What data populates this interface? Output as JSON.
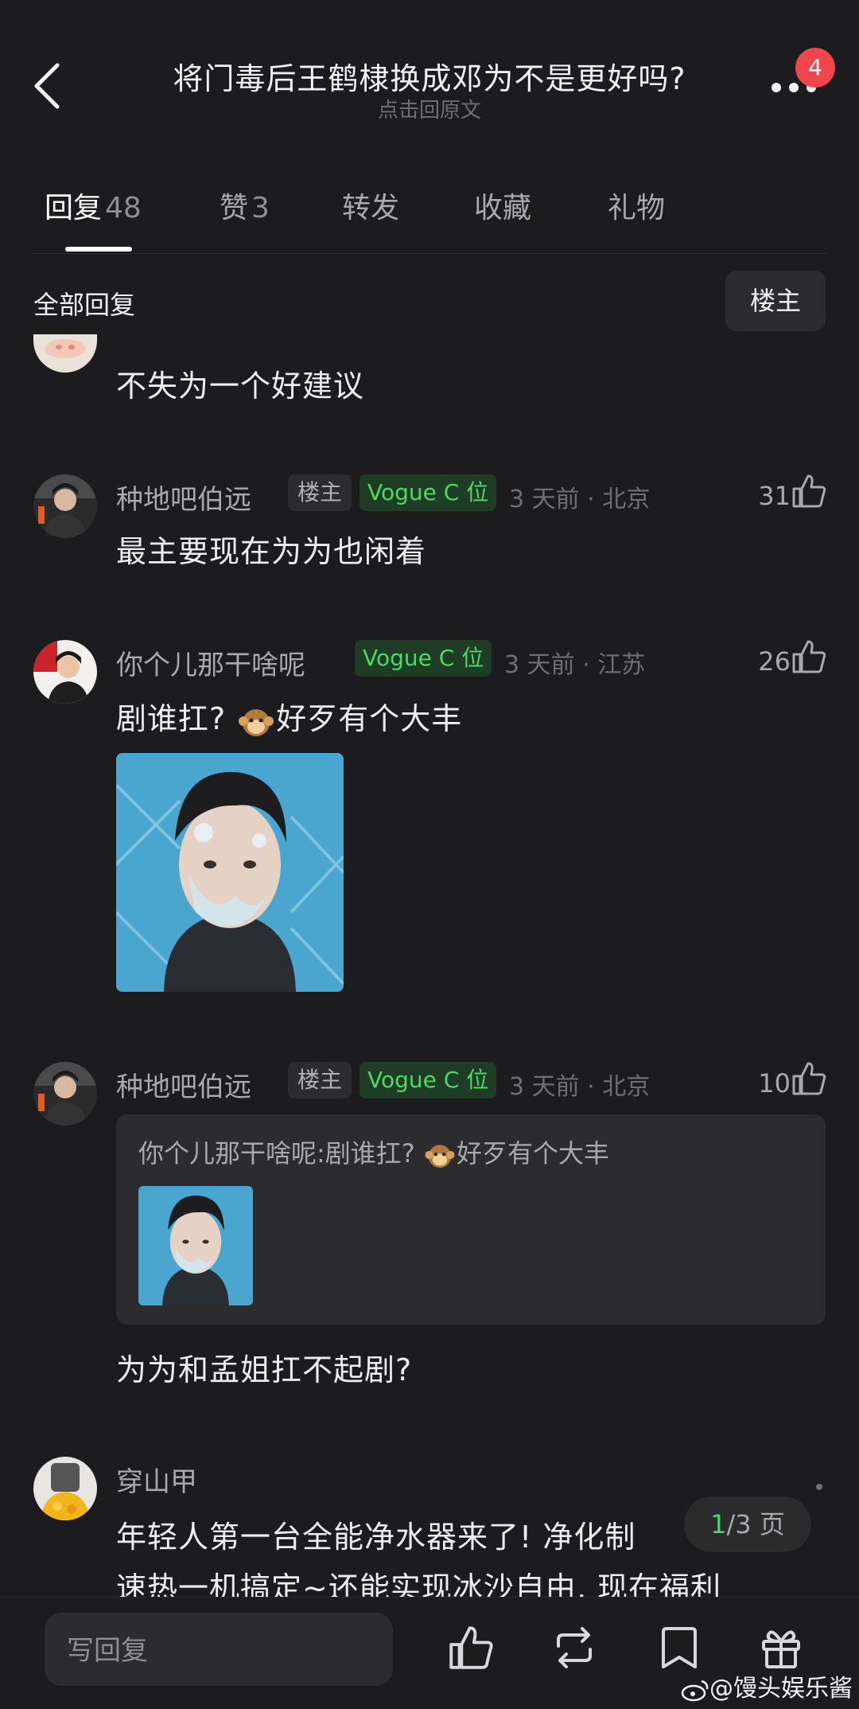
{
  "header": {
    "title": "将门毒后王鹤棣换成邓为不是更好吗?",
    "subtitle": "点击回原文",
    "badge_count": "4"
  },
  "tabs": [
    {
      "label": "回复",
      "count": "48",
      "active": true
    },
    {
      "label": "赞",
      "count": "3"
    },
    {
      "label": "转发",
      "count": ""
    },
    {
      "label": "收藏",
      "count": ""
    },
    {
      "label": "礼物",
      "count": ""
    }
  ],
  "filter": {
    "all_replies": "全部回复",
    "op_only": "楼主"
  },
  "comments": [
    {
      "text": "不失为一个好建议"
    },
    {
      "user": "种地吧伯远",
      "op_tag": "楼主",
      "vogue_tag": "Vogue C 位",
      "meta": "3 天前 · 北京",
      "likes": "31",
      "text": "最主要现在为为也闲着"
    },
    {
      "user": "你个儿那干啥呢",
      "vogue_tag": "Vogue C 位",
      "meta": "3 天前 · 江苏",
      "likes": "26",
      "text_pre": "剧谁扛? ",
      "text_post": "好歹有个大丰"
    },
    {
      "user": "种地吧伯远",
      "op_tag": "楼主",
      "vogue_tag": "Vogue C 位",
      "meta": "3 天前 · 北京",
      "likes": "10",
      "quote_pre": "你个儿那干啥呢:剧谁扛? ",
      "quote_post": "好歹有个大丰",
      "text": "为为和孟姐扛不起剧?"
    },
    {
      "user": "穿山甲",
      "text_line1": "年轻人第一台全能净水器来了! 净化制",
      "text_line2": "速热一机搞定~还能实现冰沙自由, 现在福利"
    }
  ],
  "pager": {
    "current": "1",
    "rest": "/3 页"
  },
  "bottom": {
    "placeholder": "写回复"
  },
  "watermark": "@馒头娱乐酱",
  "colors": {
    "background": "#1c1c1e",
    "accent_green": "#4cd964",
    "badge_red": "#f0454c"
  }
}
